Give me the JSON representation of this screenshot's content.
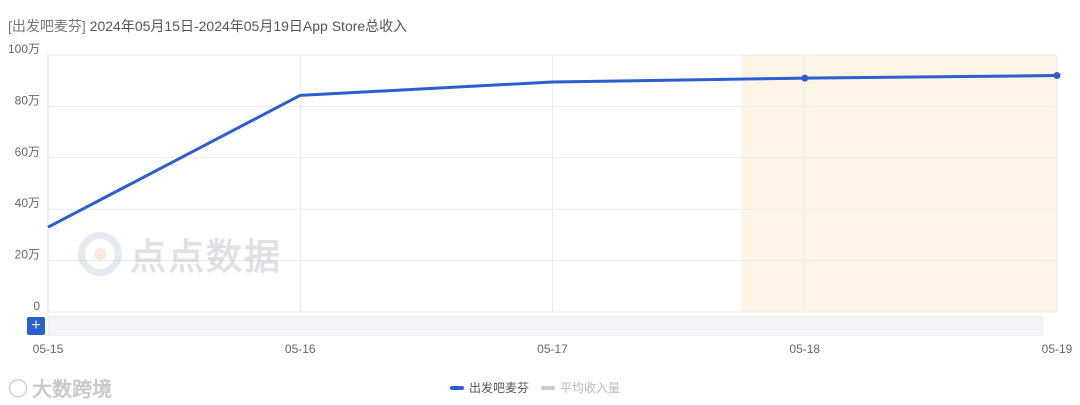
{
  "title": {
    "app_name": "[出发吧麦芬]",
    "text": "2024年05月15日-2024年05月19日App Store总收入"
  },
  "chart_data": {
    "type": "line",
    "categories": [
      "05-15",
      "05-16",
      "05-17",
      "05-18",
      "05-19"
    ],
    "series": [
      {
        "name": "出发吧麦芬",
        "values": [
          330000,
          843000,
          895000,
          910000,
          920000
        ],
        "color": "#2d5ecf"
      }
    ],
    "y_ticks": [
      {
        "value": 0,
        "label": "0"
      },
      {
        "value": 200000,
        "label": "20万"
      },
      {
        "value": 400000,
        "label": "40万"
      },
      {
        "value": 600000,
        "label": "60万"
      },
      {
        "value": 800000,
        "label": "80万"
      },
      {
        "value": 1000000,
        "label": "100万"
      }
    ],
    "ylim": [
      0,
      1000000
    ],
    "highlight_range": [
      "05-18",
      "05-19"
    ],
    "highlight_color": "#fdf4e6",
    "grid": true,
    "legend_position": "bottom"
  },
  "legend": [
    {
      "label": "出发吧麦芬",
      "color": "#2d5ecf",
      "active": true
    },
    {
      "label": "平均收入量",
      "color": "#cccccc",
      "active": false
    }
  ],
  "watermark": {
    "text": "点点数据"
  },
  "brand": {
    "text": "大数跨境",
    "icon": "brand-logo-icon"
  },
  "zoom": {
    "button_label": "+"
  }
}
